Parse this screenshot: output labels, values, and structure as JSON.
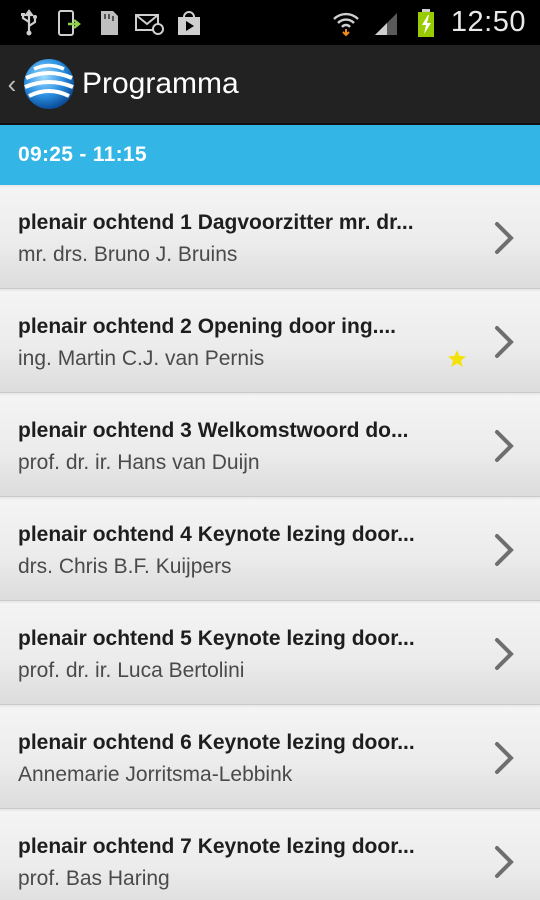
{
  "status_bar": {
    "time": "12:50",
    "left_icons": [
      "usb-icon",
      "phone-sync-icon",
      "sd-card-icon",
      "email-icon",
      "play-store-icon"
    ],
    "right_icons": [
      "wifi-icon",
      "signal-icon",
      "battery-charging-icon"
    ]
  },
  "action_bar": {
    "title": "Programma"
  },
  "section": {
    "time_range": "09:25 - 11:15"
  },
  "sessions": [
    {
      "title": "plenair ochtend 1 Dagvoorzitter mr. dr...",
      "speaker": "mr. drs. Bruno J. Bruins",
      "starred": false
    },
    {
      "title": "plenair ochtend 2 Opening door ing....",
      "speaker": "ing. Martin C.J. van Pernis",
      "starred": true
    },
    {
      "title": "plenair ochtend 3 Welkomstwoord do...",
      "speaker": "prof. dr. ir. Hans van Duijn",
      "starred": false
    },
    {
      "title": "plenair ochtend 4 Keynote lezing door...",
      "speaker": "drs. Chris B.F. Kuijpers",
      "starred": false
    },
    {
      "title": "plenair ochtend 5 Keynote lezing door...",
      "speaker": "prof. dr. ir. Luca Bertolini",
      "starred": false
    },
    {
      "title": "plenair ochtend 6 Keynote lezing door...",
      "speaker": "Annemarie Jorritsma-Lebbink",
      "starred": false
    },
    {
      "title": "plenair ochtend 7 Keynote lezing door...",
      "speaker": "prof. Bas Haring",
      "starred": false
    }
  ],
  "colors": {
    "section_header": "#33b5e5",
    "star": "#f5e10a",
    "action_bar": "#222222"
  }
}
